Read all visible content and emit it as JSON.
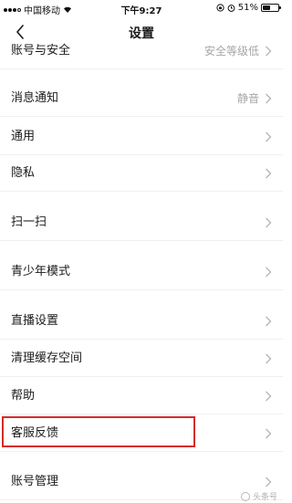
{
  "status_bar": {
    "carrier": "中国移动",
    "time": "下午9:27",
    "battery_percent": "51%",
    "battery_level": 0.51
  },
  "nav": {
    "title": "设置",
    "back_icon": "chevron-left-icon"
  },
  "settings": {
    "items": [
      {
        "label": "账号与安全",
        "value": "安全等级低"
      },
      {
        "label": "消息通知",
        "value": "静音"
      },
      {
        "label": "通用",
        "value": ""
      },
      {
        "label": "隐私",
        "value": ""
      },
      {
        "label": "扫一扫",
        "value": ""
      },
      {
        "label": "青少年模式",
        "value": ""
      },
      {
        "label": "直播设置",
        "value": ""
      },
      {
        "label": "清理缓存空间",
        "value": ""
      },
      {
        "label": "帮助",
        "value": ""
      },
      {
        "label": "客服反馈",
        "value": ""
      },
      {
        "label": "账号管理",
        "value": ""
      }
    ]
  },
  "annotation": {
    "highlight_color": "#d62a2a",
    "highlighted_item": "客服反馈"
  },
  "watermark": {
    "text": "头条号"
  }
}
